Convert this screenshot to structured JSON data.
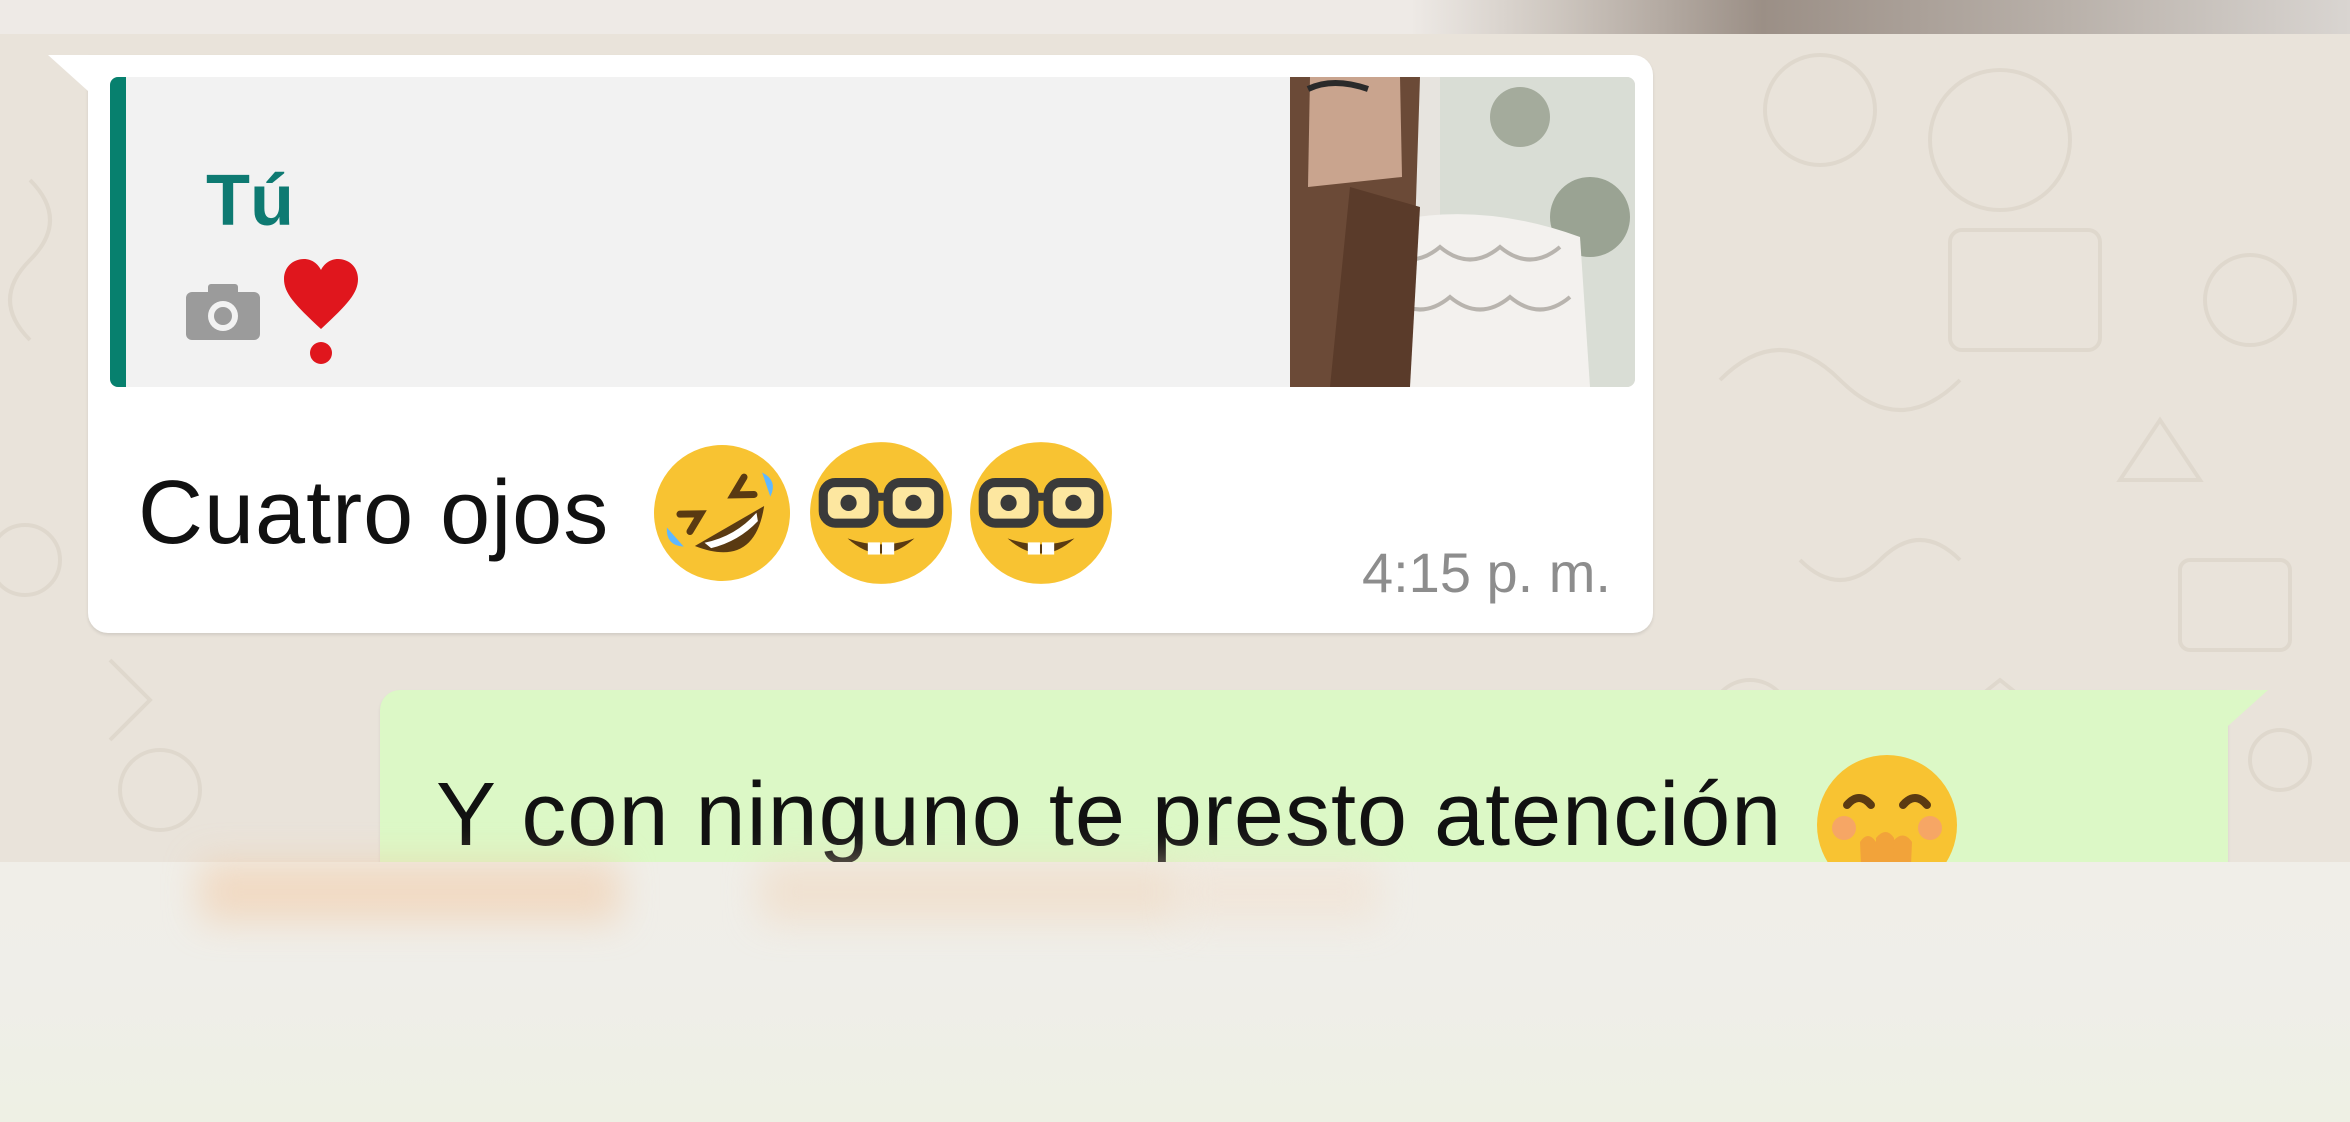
{
  "quote": {
    "author": "Tú",
    "icons": [
      "camera-icon",
      "heart-exclamation-icon"
    ]
  },
  "message_in": {
    "text": "Cuatro ojos",
    "emojis": [
      "rolling-on-floor-laughing-icon",
      "nerd-face-icon",
      "nerd-face-icon"
    ],
    "time": "4:15 p. m."
  },
  "message_out": {
    "text": "Y con ninguno te presto atención",
    "emojis": [
      "hand-over-mouth-icon"
    ]
  },
  "colors": {
    "incoming_bubble": "#ffffff",
    "outgoing_bubble": "#dcf8c6",
    "quote_accent": "#07806e",
    "quote_author": "#0e7a72",
    "timestamp": "#8d8d8d",
    "wallpaper": "#e9e3da"
  }
}
